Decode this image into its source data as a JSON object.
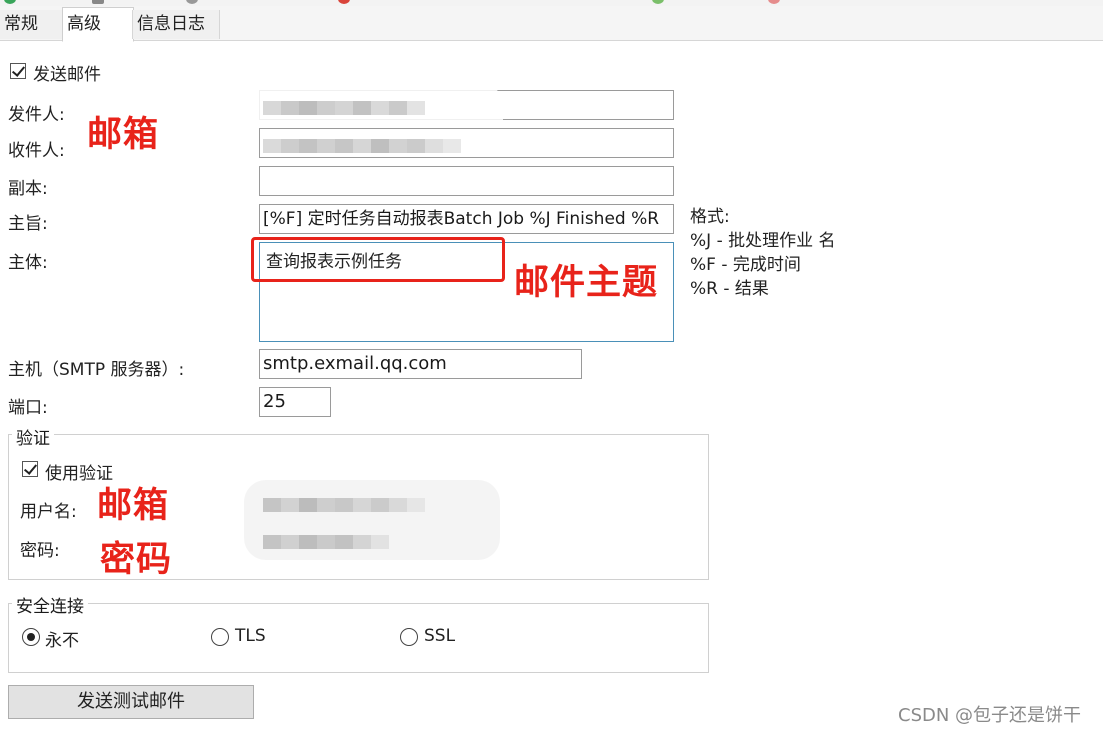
{
  "tabs": {
    "general": "常规",
    "advanced": "高级",
    "log": "信息日志"
  },
  "send_mail": {
    "label": "发送邮件",
    "checked": true
  },
  "fields": {
    "sender_label": "发件人:",
    "recipient_label": "收件人:",
    "cc_label": "副本:",
    "cc_value": "",
    "subject_label": "主旨:",
    "subject_value": "[%F] 定时任务自动报表Batch Job %J Finished %R",
    "body_label": "主体:",
    "body_value": "查询报表示例任务",
    "host_label": "主机（SMTP 服务器）:",
    "host_value": "smtp.exmail.qq.com",
    "port_label": "端口:",
    "port_value": "25"
  },
  "format_hint": {
    "title": "格式:",
    "j": "%J - 批处理作业 名",
    "f": "%F - 完成时间",
    "r": "%R - 结果"
  },
  "auth": {
    "group_title": "验证",
    "use_auth_label": "使用验证",
    "use_auth_checked": true,
    "username_label": "用户名:",
    "password_label": "密码:"
  },
  "security": {
    "group_title": "安全连接",
    "options": [
      "永不",
      "TLS",
      "SSL"
    ],
    "selected": "永不"
  },
  "test_button": "发送测试邮件",
  "annotations": {
    "mailbox_1": "邮箱",
    "mail_subject": "邮件主题",
    "mailbox_2": "邮箱",
    "password": "密码"
  },
  "watermark": "CSDN @包子还是饼干",
  "colors": {
    "annotation_red": "#e8231a",
    "body_border": "#4a90b8"
  }
}
